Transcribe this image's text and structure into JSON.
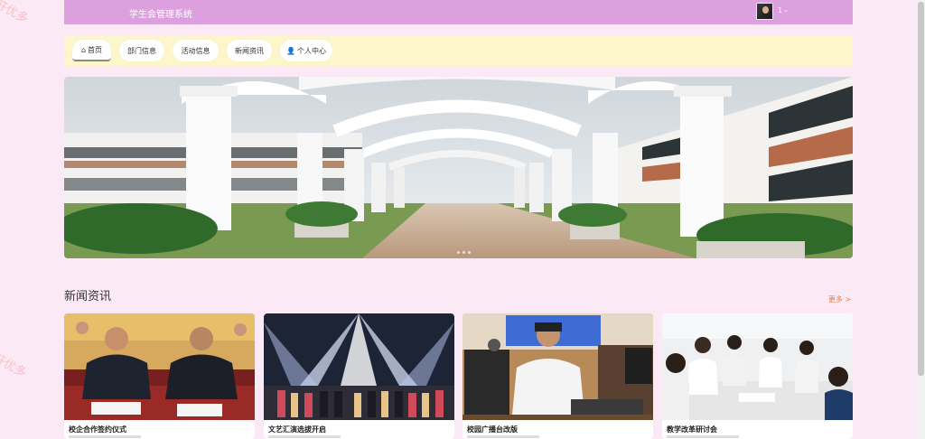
{
  "watermark": "开优多",
  "header": {
    "title": "学生会管理系统",
    "user_name": "1",
    "caret": "⌄"
  },
  "nav": {
    "tabs": [
      {
        "label": "首页",
        "icon": "home-icon",
        "glyph": "⌂"
      },
      {
        "label": "部门信息"
      },
      {
        "label": "活动信息"
      },
      {
        "label": "新闻资讯"
      },
      {
        "label": "个人中心",
        "icon": "user-icon",
        "glyph": "👤"
      }
    ]
  },
  "banner": {
    "slides": 3
  },
  "news": {
    "title": "新闻资讯",
    "more": "更多 >",
    "items": [
      {
        "title": "校企合作签约仪式"
      },
      {
        "title": "文艺汇演选拔开启"
      },
      {
        "title": "校园广播台改版"
      },
      {
        "title": "教学改革研讨会"
      }
    ]
  },
  "colors": {
    "page_bg": "#fbe9f5",
    "header_bg": "#dba0dd",
    "nav_bg": "#fdf6cb",
    "more_link": "#e57e3c"
  }
}
